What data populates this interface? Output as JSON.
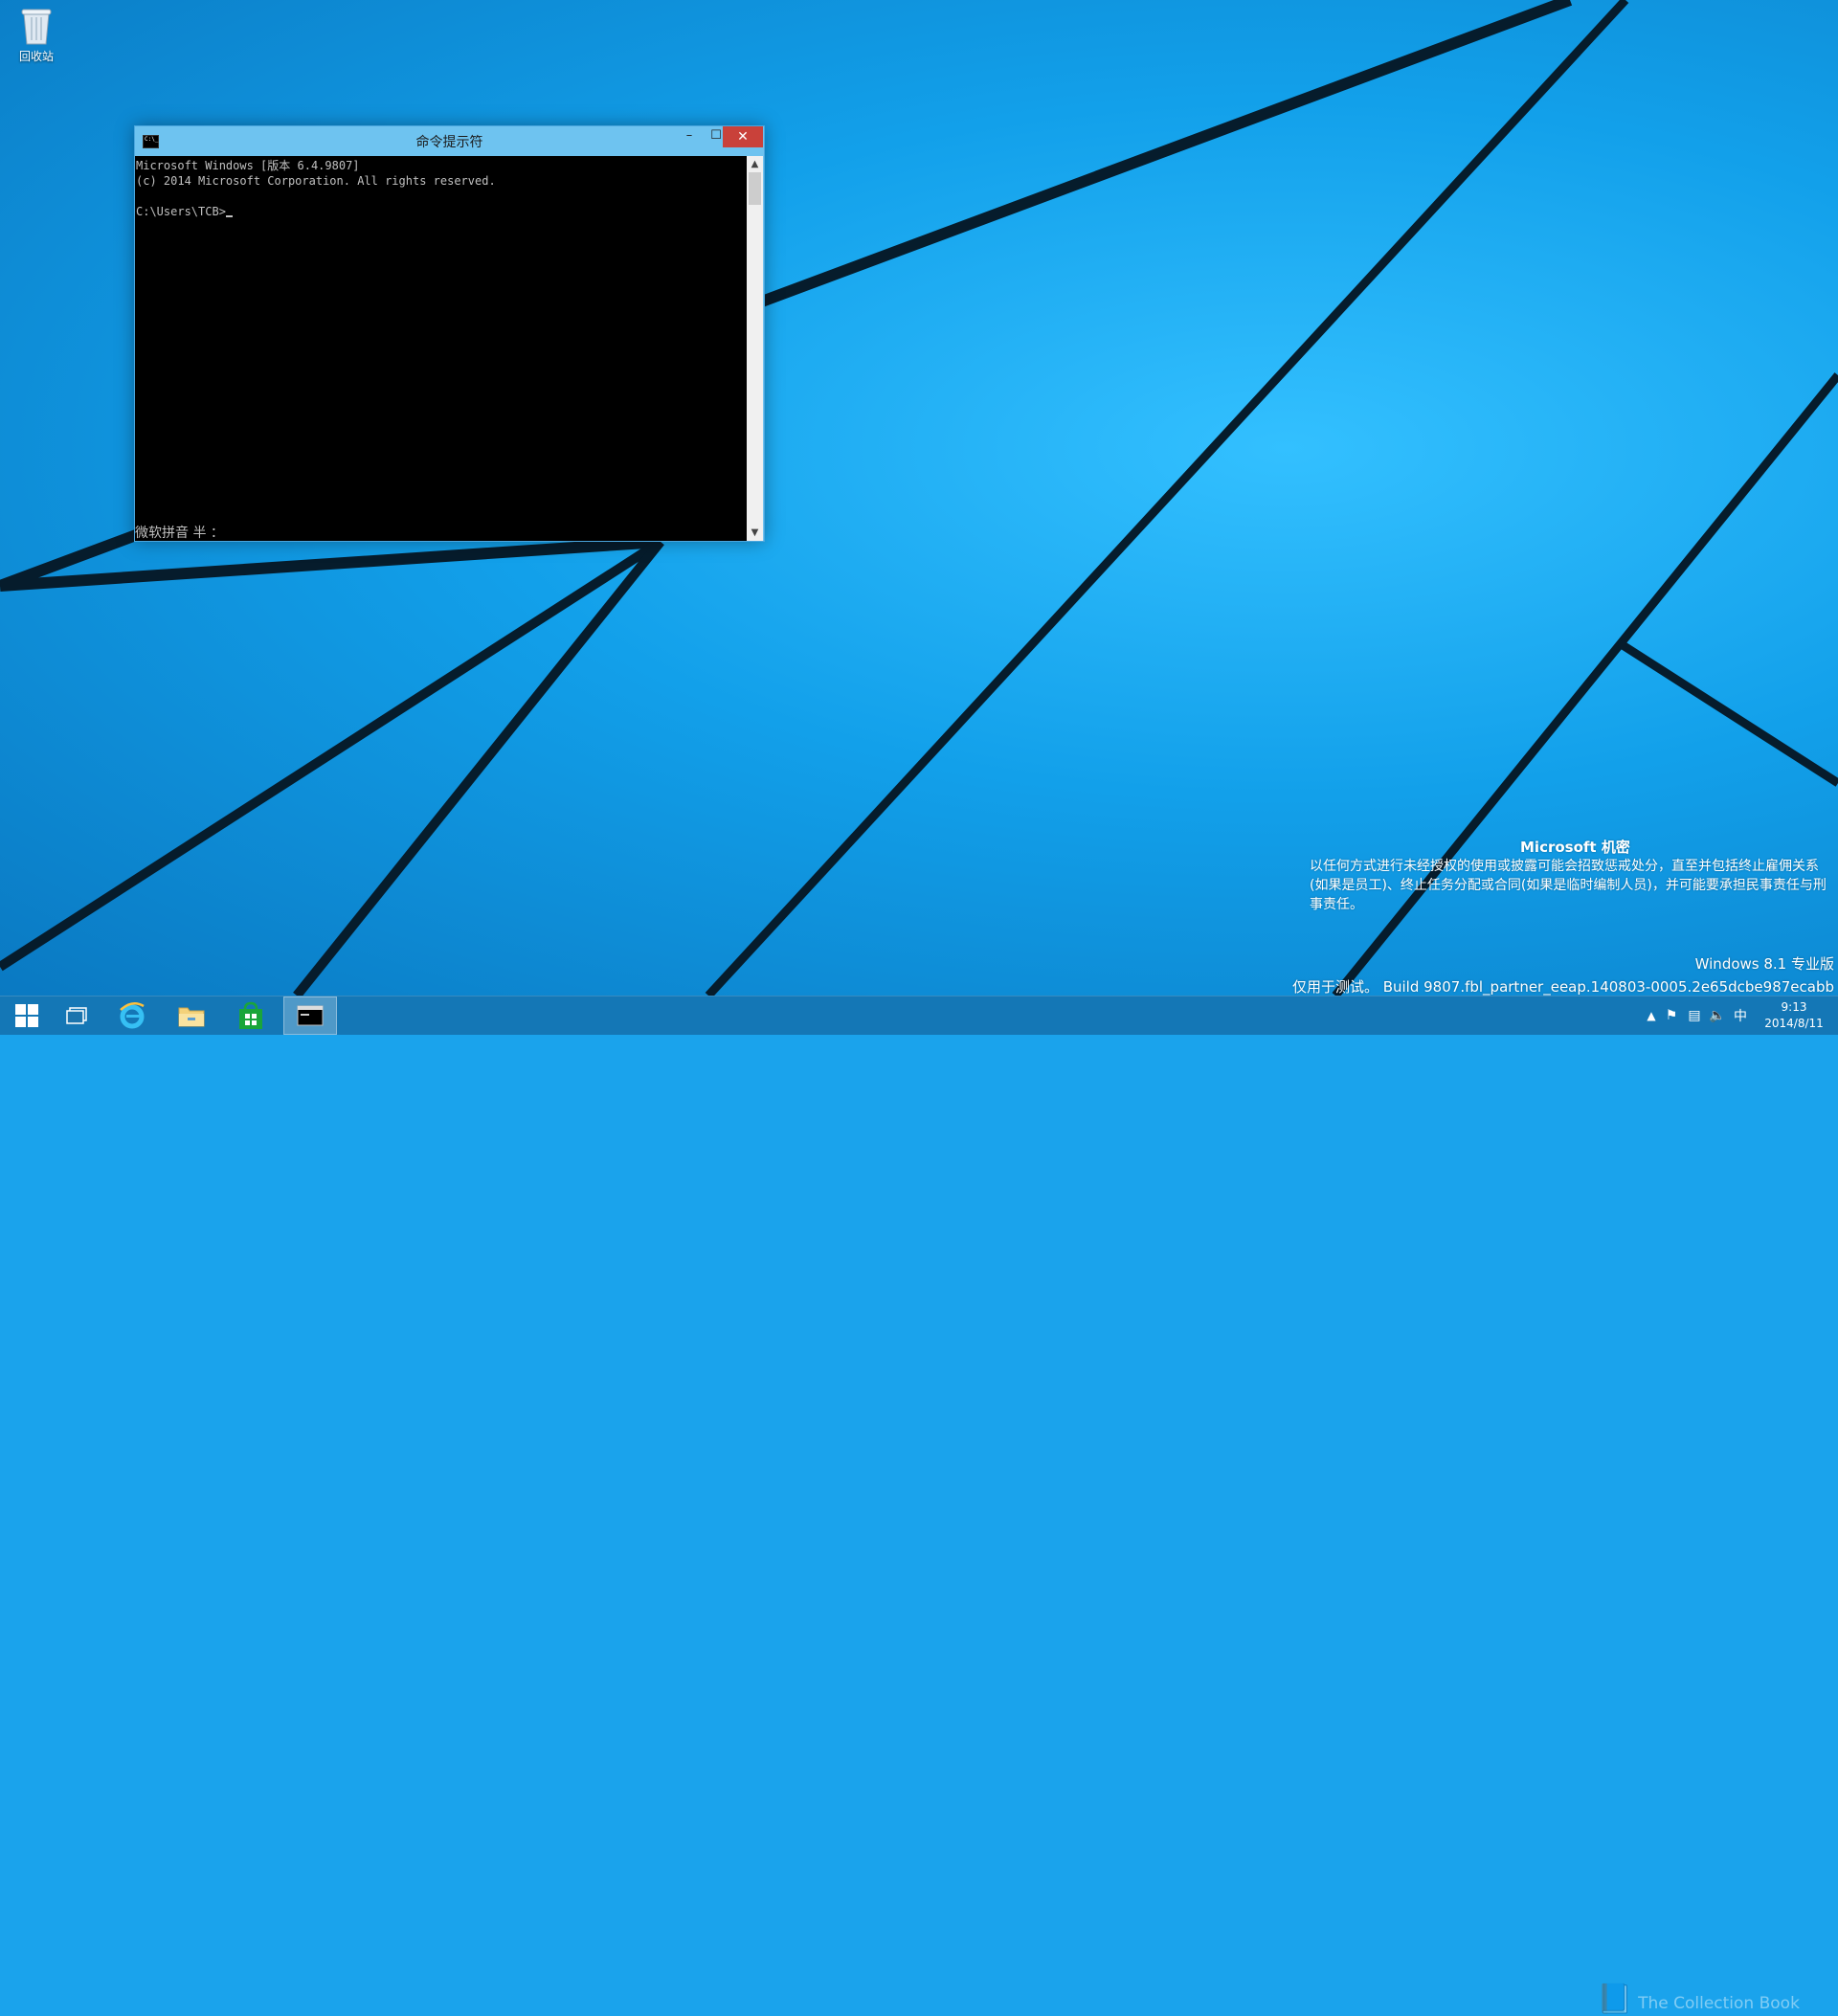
{
  "desktop": {
    "recycle_bin_label": "回收站"
  },
  "cmd_window": {
    "title": "命令提示符",
    "icon_label": "C:\\_",
    "min_glyph": "–",
    "max_glyph": "☐",
    "close_glyph": "✕",
    "lines": [
      "Microsoft Windows [版本 6.4.9807]",
      "(c) 2014 Microsoft Corporation. All rights reserved.",
      "",
      "C:\\Users\\TCB>"
    ],
    "ime_status": "微软拼音 半 ："
  },
  "watermark": {
    "title": "Microsoft 机密",
    "body": "以任何方式进行未经授权的使用或披露可能会招致惩戒处分，直至并包括终止雇佣关系(如果是员工)、终止任务分配或合同(如果是临时编制人员)，并可能要承担民事责任与刑事责任。",
    "edition": "Windows 8.1 专业版",
    "build": "仅用于测试。 Build 9807.fbl_partner_eeap.140803-0005.2e65dcbe987ecabb"
  },
  "taskbar": {
    "tray_ime": "中",
    "time": "9:13",
    "date": "2014/8/11",
    "site_watermark": "The Collection Book"
  },
  "colors": {
    "accent": "#1aa3ec",
    "titlebar": "#6ec3f0",
    "close": "#c9413a"
  }
}
